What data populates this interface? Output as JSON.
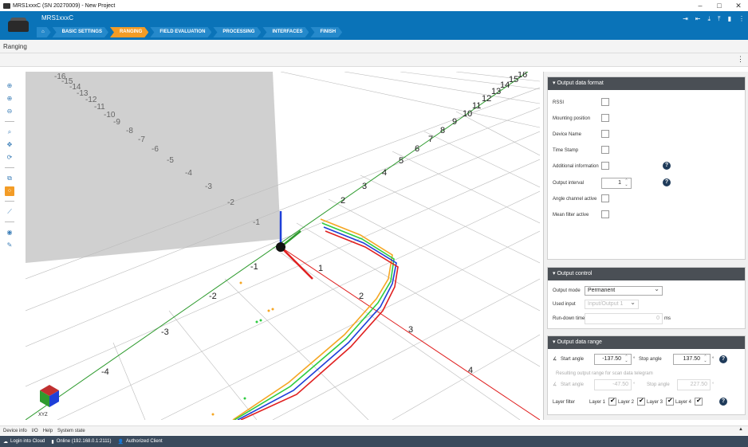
{
  "window": {
    "title": "MRS1xxxC (SN 20270009) - New Project",
    "controls": [
      "–",
      "□",
      "✕"
    ]
  },
  "header": {
    "device_name": "MRS1xxxC",
    "steps": [
      {
        "label": "BASIC SETTINGS"
      },
      {
        "label": "RANGING"
      },
      {
        "label": "FIELD EVALUATION"
      },
      {
        "label": "PROCESSING"
      },
      {
        "label": "INTERFACES"
      },
      {
        "label": "FINISH"
      }
    ],
    "icons": [
      "login-icon",
      "logout-icon",
      "download-icon",
      "upload-icon",
      "save-icon",
      "more-icon"
    ]
  },
  "page": {
    "title": "Ranging",
    "more_glyph": "⋮"
  },
  "left_tools": [
    "zoom-in-icon",
    "zoom-extent-icon",
    "zoom-out-icon",
    "search-icon",
    "pan-icon",
    "rotate-icon",
    "view-3d-icon",
    "point-cloud-icon",
    "measure-icon",
    "eye-icon",
    "wrench-icon"
  ],
  "view3d": {
    "green_axis_labels": [
      "-4",
      "-3",
      "-2",
      "-1",
      "1",
      "2",
      "3",
      "4",
      "5",
      "6",
      "7",
      "8",
      "9",
      "10",
      "11",
      "12",
      "13",
      "14",
      "15",
      "16"
    ],
    "grey_axis_labels": [
      "-1",
      "-2",
      "-3",
      "-4",
      "-5",
      "-6",
      "-7",
      "-8",
      "-9",
      "-10",
      "-11",
      "-12",
      "-13",
      "-14",
      "-15",
      "-16"
    ],
    "red_axis_labels": [
      "1",
      "2",
      "3",
      "4"
    ],
    "cube_label": "XYZ"
  },
  "output_data_format": {
    "title": "Output data format",
    "fields": [
      {
        "label": "RSSI",
        "checked": false
      },
      {
        "label": "Mounting position",
        "checked": false
      },
      {
        "label": "Device Name",
        "checked": false
      },
      {
        "label": "Time Stamp",
        "checked": false
      },
      {
        "label": "Additional information",
        "checked": false
      },
      {
        "label": "Output interval",
        "value": "1"
      },
      {
        "label": "Angle channel active",
        "checked": false
      },
      {
        "label": "Mean filter active",
        "checked": false
      }
    ]
  },
  "output_control": {
    "title": "Output control",
    "output_mode_label": "Output mode",
    "output_mode_value": "Permanent",
    "used_input_label": "Used input",
    "used_input_value": "Input/Output 1",
    "run_down_label": "Run-down time",
    "run_down_value": "0",
    "run_down_unit": "ms"
  },
  "output_data_range": {
    "title": "Output data range",
    "start_label": "Start angle",
    "start_value": "-137.50",
    "stop_label": "Stop angle",
    "stop_value": "137.50",
    "deg": "°",
    "resulting_label": "Resulting output range for scan data telegram",
    "res_start_label": "Start angle",
    "res_start_value": "-47.50",
    "res_stop_label": "Stop angle",
    "res_stop_value": "227.50",
    "layer_filter_label": "Layer filter",
    "layers": [
      {
        "label": "Layer 1",
        "checked": true
      },
      {
        "label": "Layer 2",
        "checked": true
      },
      {
        "label": "Layer 3",
        "checked": true
      },
      {
        "label": "Layer 4",
        "checked": true
      }
    ]
  },
  "bottom_menu": [
    "Device info",
    "I/O",
    "Help",
    "System state"
  ],
  "status": {
    "cloud": "Login into Cloud",
    "online": "Online (192.168.0.1:2111)",
    "user": "Authorized Client"
  },
  "colors": {
    "brand": "#0a73b8",
    "active_step": "#f39c26",
    "panel_header": "#4a4f55",
    "status_bar": "#3a4a5c"
  }
}
